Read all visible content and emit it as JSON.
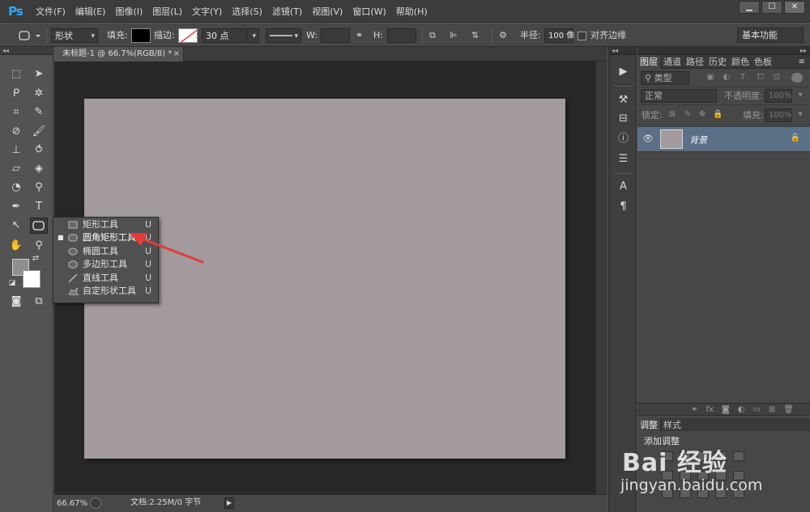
{
  "app": {
    "logo": "Ps"
  },
  "menu": [
    "文件(F)",
    "编辑(E)",
    "图像(I)",
    "图层(L)",
    "文字(Y)",
    "选择(S)",
    "滤镜(T)",
    "视图(V)",
    "窗口(W)",
    "帮助(H)"
  ],
  "window_controls": {
    "minimize": "▁",
    "maximize": "☐",
    "close": "✕"
  },
  "options": {
    "mode_value": "形状",
    "fill_label": "填充:",
    "stroke_label": "描边:",
    "stroke_width": "30 点",
    "w_label": "W:",
    "h_label": "H:",
    "radius_label": "半径:",
    "radius_value": "100 像",
    "align_edges_label": "对齐边缘",
    "workspace": "基本功能"
  },
  "document": {
    "tab_title": "未标题-1 @ 66.7%(RGB/8) *",
    "tab_close": "×",
    "canvas_color": "#a29a9c"
  },
  "status": {
    "zoom": "66.67%",
    "doc_info": "文档:2.25M/0 字节"
  },
  "shape_flyout": {
    "items": [
      {
        "label": "矩形工具",
        "key": "U",
        "icon": "rectangle-icon",
        "selected": false
      },
      {
        "label": "圆角矩形工具",
        "key": "U",
        "icon": "rounded-rectangle-icon",
        "selected": true
      },
      {
        "label": "椭圆工具",
        "key": "U",
        "icon": "ellipse-icon",
        "selected": false
      },
      {
        "label": "多边形工具",
        "key": "U",
        "icon": "polygon-icon",
        "selected": false
      },
      {
        "label": "直线工具",
        "key": "U",
        "icon": "line-icon",
        "selected": false
      },
      {
        "label": "自定形状工具",
        "key": "U",
        "icon": "custom-shape-icon",
        "selected": false
      }
    ]
  },
  "layers_panel": {
    "tabs": [
      "图层",
      "通道",
      "路径",
      "历史",
      "颜色",
      "色板"
    ],
    "filter_kind": "类型",
    "blend_mode": "正常",
    "opacity_label": "不透明度:",
    "opacity_value": "100%",
    "lock_label": "锁定:",
    "fill_label": "填充:",
    "fill_value": "100%",
    "layers": [
      {
        "name": "背景",
        "locked": true,
        "visible": true
      }
    ]
  },
  "adjustments_panel": {
    "tabs": [
      "调整",
      "样式"
    ],
    "title": "添加调整"
  },
  "watermark": {
    "brand": "Bai 经验",
    "url": "jingyan.baidu.com"
  },
  "colors": {
    "accent_blue": "#31a8ff",
    "selected_layer": "#5b6f86",
    "annotation_red": "#e23c3c"
  }
}
